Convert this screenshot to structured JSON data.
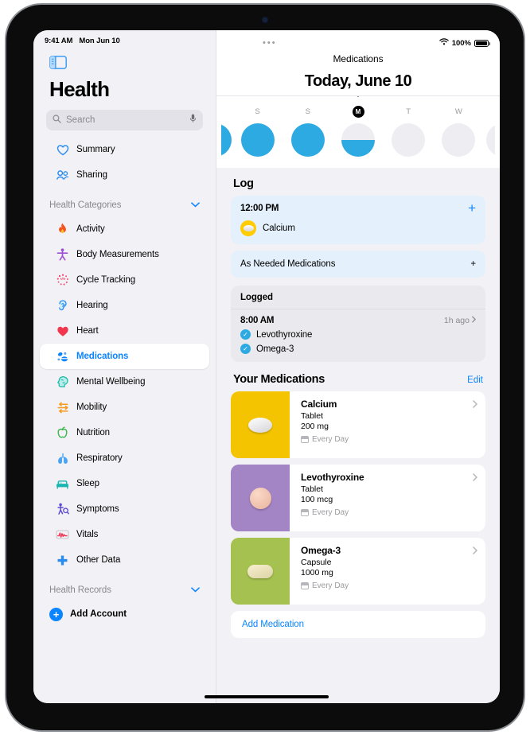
{
  "status_bar": {
    "time": "9:41 AM",
    "date": "Mon Jun 10",
    "battery_percent": "100%",
    "wifi_icon": "wifi-icon",
    "battery_icon": "battery-icon",
    "more_dots": "•••"
  },
  "sidebar": {
    "toggle_icon": "sidebar-toggle-icon",
    "title": "Health",
    "search": {
      "placeholder": "Search",
      "value": "",
      "icon": "search-icon",
      "mic_icon": "microphone-icon"
    },
    "top_items": [
      {
        "label": "Summary",
        "icon": "heart-outline-icon"
      },
      {
        "label": "Sharing",
        "icon": "people-icon"
      }
    ],
    "categories_header": {
      "label": "Health Categories",
      "chevron": "chevron-down-icon"
    },
    "categories": [
      {
        "label": "Activity",
        "icon": "flame-icon",
        "selected": false
      },
      {
        "label": "Body Measurements",
        "icon": "body-icon",
        "selected": false
      },
      {
        "label": "Cycle Tracking",
        "icon": "cycle-icon",
        "selected": false
      },
      {
        "label": "Hearing",
        "icon": "ear-icon",
        "selected": false
      },
      {
        "label": "Heart",
        "icon": "heart-filled-icon",
        "selected": false
      },
      {
        "label": "Medications",
        "icon": "pills-icon",
        "selected": true
      },
      {
        "label": "Mental Wellbeing",
        "icon": "brain-icon",
        "selected": false
      },
      {
        "label": "Mobility",
        "icon": "mobility-arrows-icon",
        "selected": false
      },
      {
        "label": "Nutrition",
        "icon": "apple-icon",
        "selected": false
      },
      {
        "label": "Respiratory",
        "icon": "lungs-icon",
        "selected": false
      },
      {
        "label": "Sleep",
        "icon": "bed-icon",
        "selected": false
      },
      {
        "label": "Symptoms",
        "icon": "symptoms-icon",
        "selected": false
      },
      {
        "label": "Vitals",
        "icon": "waveform-icon",
        "selected": false
      },
      {
        "label": "Other Data",
        "icon": "plus-cross-icon",
        "selected": false
      }
    ],
    "records_header": {
      "label": "Health Records",
      "chevron": "chevron-down-icon"
    },
    "add_account": {
      "label": "Add Account",
      "icon": "plus-circle-icon"
    }
  },
  "main": {
    "nav_title": "Medications",
    "date_heading": "Today, June 10",
    "week": {
      "days": [
        {
          "letter": "",
          "state": "full",
          "today": false,
          "edge": "left"
        },
        {
          "letter": "S",
          "state": "full",
          "today": false
        },
        {
          "letter": "S",
          "state": "full",
          "today": false
        },
        {
          "letter": "M",
          "state": "half",
          "today": true
        },
        {
          "letter": "T",
          "state": "empty",
          "today": false
        },
        {
          "letter": "W",
          "state": "empty",
          "today": false
        },
        {
          "letter": "",
          "state": "empty",
          "today": false,
          "edge": "right"
        }
      ]
    },
    "log": {
      "title": "Log",
      "scheduled": {
        "time": "12:00 PM",
        "add_icon": "plus-icon",
        "medication": {
          "name": "Calcium",
          "color": "#ffcc00"
        }
      },
      "as_needed": {
        "label": "As Needed Medications",
        "add_icon": "plus-icon"
      }
    },
    "logged": {
      "title": "Logged",
      "time": "8:00 AM",
      "ago": "1h ago",
      "chevron": "chevron-right-icon",
      "items": [
        {
          "name": "Levothyroxine",
          "checked": true
        },
        {
          "name": "Omega-3",
          "checked": true
        }
      ]
    },
    "your_medications": {
      "title": "Your Medications",
      "edit_label": "Edit",
      "items": [
        {
          "name": "Calcium",
          "form": "Tablet",
          "dose": "200 mg",
          "frequency": "Every Day",
          "thumb_color": "#f5c400",
          "pill_shape": "oval"
        },
        {
          "name": "Levothyroxine",
          "form": "Tablet",
          "dose": "100 mcg",
          "frequency": "Every Day",
          "thumb_color": "#a384c4",
          "pill_shape": "round"
        },
        {
          "name": "Omega-3",
          "form": "Capsule",
          "dose": "1000 mg",
          "frequency": "Every Day",
          "thumb_color": "#a5c250",
          "pill_shape": "capsule"
        }
      ],
      "add_label": "Add Medication"
    }
  },
  "colors": {
    "accent": "#0a84ff",
    "dot_blue": "#2eaae3",
    "bg": "#f2f1f6"
  }
}
